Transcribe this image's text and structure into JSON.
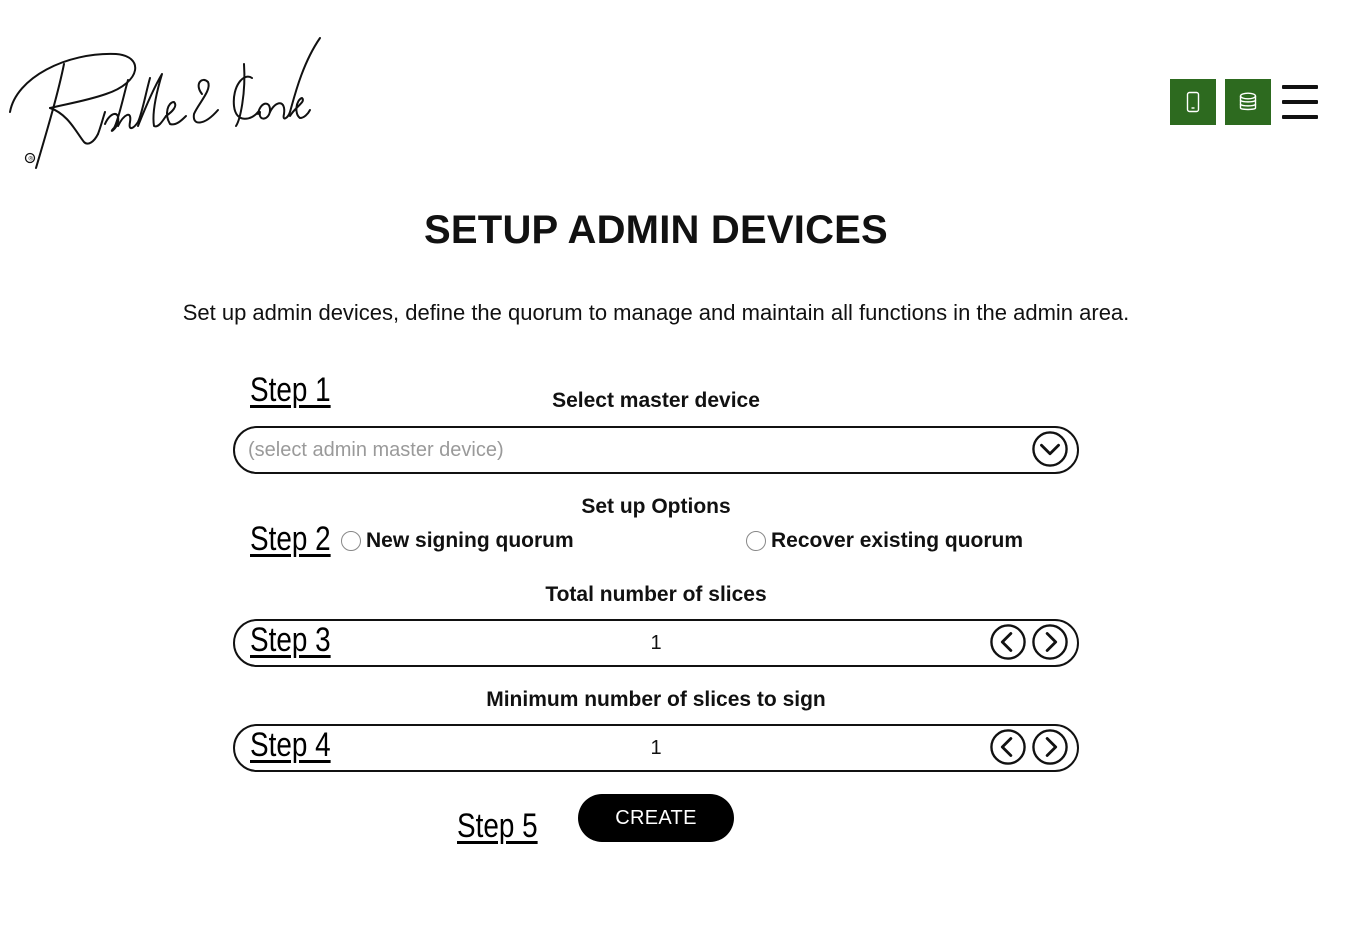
{
  "brand": {
    "logo_text": "Riddle&Code",
    "registered_mark": "®"
  },
  "header": {
    "device_icon": "smartphone-icon",
    "database_icon": "database-icon",
    "menu_icon": "hamburger-menu-icon",
    "accent_color": "#2d6a1f"
  },
  "page": {
    "title": "SETUP ADMIN DEVICES",
    "description": "Set up admin devices, define the quorum to manage and maintain all functions in the admin area."
  },
  "steps": {
    "step1": {
      "label": "Step 1",
      "section_title": "Select master device",
      "placeholder": "(select admin master device)",
      "dropdown_icon": "chevron-down-icon"
    },
    "step2": {
      "label": "Step 2",
      "section_title": "Set up Options",
      "options": [
        "New signing quorum",
        "Recover existing quorum"
      ]
    },
    "step3": {
      "label": "Step 3",
      "section_title": "Total number of slices",
      "value": "1"
    },
    "step4": {
      "label": "Step 4",
      "section_title": "Minimum number of slices to sign",
      "value": "1"
    },
    "step5": {
      "label": "Step 5",
      "button_label": "CREATE"
    }
  }
}
